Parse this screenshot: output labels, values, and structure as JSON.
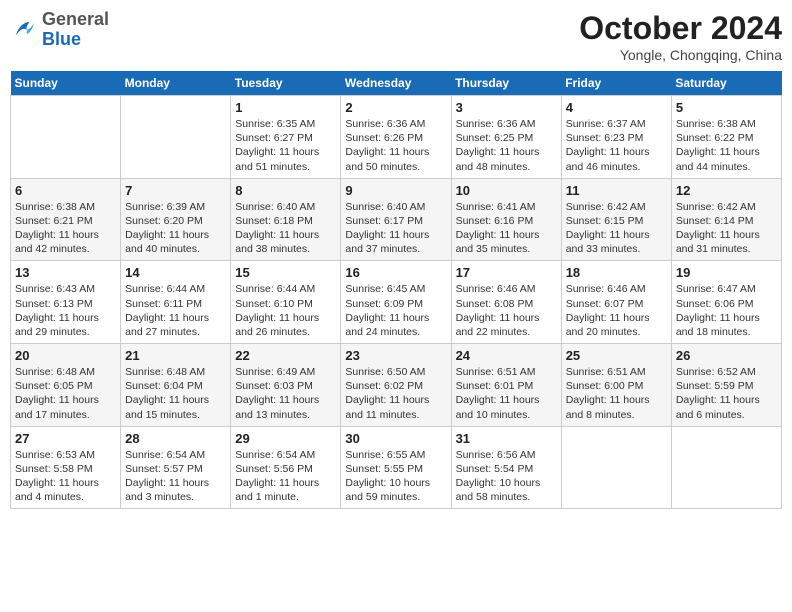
{
  "header": {
    "logo_general": "General",
    "logo_blue": "Blue",
    "title": "October 2024",
    "location": "Yongle, Chongqing, China"
  },
  "days_of_week": [
    "Sunday",
    "Monday",
    "Tuesday",
    "Wednesday",
    "Thursday",
    "Friday",
    "Saturday"
  ],
  "weeks": [
    [
      {
        "day": "",
        "info": ""
      },
      {
        "day": "",
        "info": ""
      },
      {
        "day": "1",
        "info": "Sunrise: 6:35 AM\nSunset: 6:27 PM\nDaylight: 11 hours and 51 minutes."
      },
      {
        "day": "2",
        "info": "Sunrise: 6:36 AM\nSunset: 6:26 PM\nDaylight: 11 hours and 50 minutes."
      },
      {
        "day": "3",
        "info": "Sunrise: 6:36 AM\nSunset: 6:25 PM\nDaylight: 11 hours and 48 minutes."
      },
      {
        "day": "4",
        "info": "Sunrise: 6:37 AM\nSunset: 6:23 PM\nDaylight: 11 hours and 46 minutes."
      },
      {
        "day": "5",
        "info": "Sunrise: 6:38 AM\nSunset: 6:22 PM\nDaylight: 11 hours and 44 minutes."
      }
    ],
    [
      {
        "day": "6",
        "info": "Sunrise: 6:38 AM\nSunset: 6:21 PM\nDaylight: 11 hours and 42 minutes."
      },
      {
        "day": "7",
        "info": "Sunrise: 6:39 AM\nSunset: 6:20 PM\nDaylight: 11 hours and 40 minutes."
      },
      {
        "day": "8",
        "info": "Sunrise: 6:40 AM\nSunset: 6:18 PM\nDaylight: 11 hours and 38 minutes."
      },
      {
        "day": "9",
        "info": "Sunrise: 6:40 AM\nSunset: 6:17 PM\nDaylight: 11 hours and 37 minutes."
      },
      {
        "day": "10",
        "info": "Sunrise: 6:41 AM\nSunset: 6:16 PM\nDaylight: 11 hours and 35 minutes."
      },
      {
        "day": "11",
        "info": "Sunrise: 6:42 AM\nSunset: 6:15 PM\nDaylight: 11 hours and 33 minutes."
      },
      {
        "day": "12",
        "info": "Sunrise: 6:42 AM\nSunset: 6:14 PM\nDaylight: 11 hours and 31 minutes."
      }
    ],
    [
      {
        "day": "13",
        "info": "Sunrise: 6:43 AM\nSunset: 6:13 PM\nDaylight: 11 hours and 29 minutes."
      },
      {
        "day": "14",
        "info": "Sunrise: 6:44 AM\nSunset: 6:11 PM\nDaylight: 11 hours and 27 minutes."
      },
      {
        "day": "15",
        "info": "Sunrise: 6:44 AM\nSunset: 6:10 PM\nDaylight: 11 hours and 26 minutes."
      },
      {
        "day": "16",
        "info": "Sunrise: 6:45 AM\nSunset: 6:09 PM\nDaylight: 11 hours and 24 minutes."
      },
      {
        "day": "17",
        "info": "Sunrise: 6:46 AM\nSunset: 6:08 PM\nDaylight: 11 hours and 22 minutes."
      },
      {
        "day": "18",
        "info": "Sunrise: 6:46 AM\nSunset: 6:07 PM\nDaylight: 11 hours and 20 minutes."
      },
      {
        "day": "19",
        "info": "Sunrise: 6:47 AM\nSunset: 6:06 PM\nDaylight: 11 hours and 18 minutes."
      }
    ],
    [
      {
        "day": "20",
        "info": "Sunrise: 6:48 AM\nSunset: 6:05 PM\nDaylight: 11 hours and 17 minutes."
      },
      {
        "day": "21",
        "info": "Sunrise: 6:48 AM\nSunset: 6:04 PM\nDaylight: 11 hours and 15 minutes."
      },
      {
        "day": "22",
        "info": "Sunrise: 6:49 AM\nSunset: 6:03 PM\nDaylight: 11 hours and 13 minutes."
      },
      {
        "day": "23",
        "info": "Sunrise: 6:50 AM\nSunset: 6:02 PM\nDaylight: 11 hours and 11 minutes."
      },
      {
        "day": "24",
        "info": "Sunrise: 6:51 AM\nSunset: 6:01 PM\nDaylight: 11 hours and 10 minutes."
      },
      {
        "day": "25",
        "info": "Sunrise: 6:51 AM\nSunset: 6:00 PM\nDaylight: 11 hours and 8 minutes."
      },
      {
        "day": "26",
        "info": "Sunrise: 6:52 AM\nSunset: 5:59 PM\nDaylight: 11 hours and 6 minutes."
      }
    ],
    [
      {
        "day": "27",
        "info": "Sunrise: 6:53 AM\nSunset: 5:58 PM\nDaylight: 11 hours and 4 minutes."
      },
      {
        "day": "28",
        "info": "Sunrise: 6:54 AM\nSunset: 5:57 PM\nDaylight: 11 hours and 3 minutes."
      },
      {
        "day": "29",
        "info": "Sunrise: 6:54 AM\nSunset: 5:56 PM\nDaylight: 11 hours and 1 minute."
      },
      {
        "day": "30",
        "info": "Sunrise: 6:55 AM\nSunset: 5:55 PM\nDaylight: 10 hours and 59 minutes."
      },
      {
        "day": "31",
        "info": "Sunrise: 6:56 AM\nSunset: 5:54 PM\nDaylight: 10 hours and 58 minutes."
      },
      {
        "day": "",
        "info": ""
      },
      {
        "day": "",
        "info": ""
      }
    ]
  ]
}
